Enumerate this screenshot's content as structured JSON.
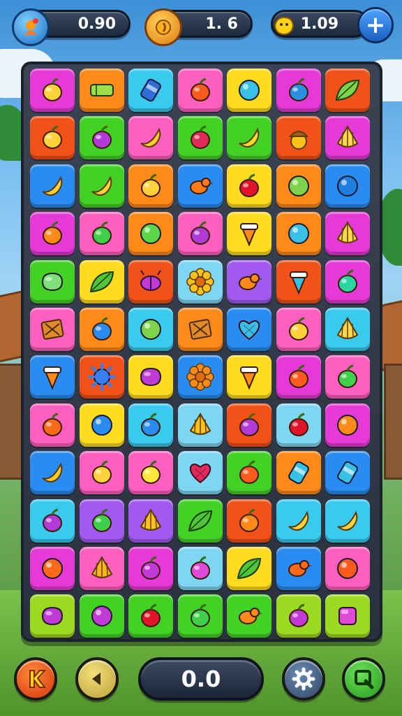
{
  "hud": {
    "stat1_value": "0.90",
    "stat2_value": "1.  6",
    "stat3_value": "1.09"
  },
  "footer": {
    "score_value": "0.0"
  },
  "colors": {
    "magenta": "#e63ad6",
    "orange": "#ff8a1a",
    "cyan": "#3ac9ef",
    "pink": "#ff5fbf",
    "yellow": "#ffdc1f",
    "purple": "#a05af0",
    "red": "#f25218",
    "green": "#44d126",
    "blue": "#2a8cf0",
    "lime": "#9cd921",
    "lightblue": "#7fd6f2"
  },
  "board": [
    [
      {
        "bg": "magenta",
        "icon": "fruit",
        "c": "#ffd23a"
      },
      {
        "bg": "orange",
        "icon": "bar",
        "c": "#9be04a"
      },
      {
        "bg": "cyan",
        "icon": "can",
        "c": "#2d6fd6"
      },
      {
        "bg": "pink",
        "icon": "fruit",
        "c": "#ff5a1e"
      },
      {
        "bg": "yellow",
        "icon": "orb",
        "c": "#39c0e6"
      },
      {
        "bg": "magenta",
        "icon": "fruit",
        "c": "#2b8fe0"
      },
      {
        "bg": "red",
        "icon": "leaf",
        "c": "#7dd34a"
      }
    ],
    [
      {
        "bg": "red",
        "icon": "fruit",
        "c": "#ffd23a"
      },
      {
        "bg": "green",
        "icon": "fruit",
        "c": "#b23ad6"
      },
      {
        "bg": "pink",
        "icon": "banana",
        "c": "#ffcc2a"
      },
      {
        "bg": "green",
        "icon": "fruit",
        "c": "#e02a5a"
      },
      {
        "bg": "green",
        "icon": "banana",
        "c": "#ffdc2a"
      },
      {
        "bg": "red",
        "icon": "acorn",
        "c": "#ffc21a"
      },
      {
        "bg": "magenta",
        "icon": "shell",
        "c": "#ffd84a"
      }
    ],
    [
      {
        "bg": "blue",
        "icon": "banana",
        "c": "#ffd23a"
      },
      {
        "bg": "green",
        "icon": "banana",
        "c": "#ffd23a"
      },
      {
        "bg": "orange",
        "icon": "fruit",
        "c": "#ffd23a"
      },
      {
        "bg": "blue",
        "icon": "bird",
        "c": "#ff7a1a"
      },
      {
        "bg": "yellow",
        "icon": "fruit",
        "c": "#e0142a"
      },
      {
        "bg": "orange",
        "icon": "orb",
        "c": "#7dd34a"
      },
      {
        "bg": "blue",
        "icon": "orb",
        "c": "#1e7fe0"
      }
    ],
    [
      {
        "bg": "magenta",
        "icon": "fruit",
        "c": "#ff8a1a"
      },
      {
        "bg": "pink",
        "icon": "fruit",
        "c": "#3fcf4a"
      },
      {
        "bg": "orange",
        "icon": "orb",
        "c": "#5ad84a"
      },
      {
        "bg": "pink",
        "icon": "fruit",
        "c": "#b23ad6"
      },
      {
        "bg": "yellow",
        "icon": "top",
        "c": "#ff8a1a"
      },
      {
        "bg": "orange",
        "icon": "orb",
        "c": "#39c0e6"
      },
      {
        "bg": "magenta",
        "icon": "shell",
        "c": "#ffd84a"
      }
    ],
    [
      {
        "bg": "green",
        "icon": "blob",
        "c": "#7de07a"
      },
      {
        "bg": "yellow",
        "icon": "leaf",
        "c": "#4fc43a"
      },
      {
        "bg": "red",
        "icon": "bug",
        "c": "#c23ad6"
      },
      {
        "bg": "lightblue",
        "icon": "flower",
        "c": "#ffc21a"
      },
      {
        "bg": "purple",
        "icon": "bird",
        "c": "#ff8a1a"
      },
      {
        "bg": "red",
        "icon": "top",
        "c": "#39c0e6"
      },
      {
        "bg": "magenta",
        "icon": "fruit",
        "c": "#2ad6a0"
      }
    ],
    [
      {
        "bg": "pink",
        "icon": "crate",
        "c": "#e08a2a"
      },
      {
        "bg": "orange",
        "icon": "fruit",
        "c": "#2a8cf0"
      },
      {
        "bg": "cyan",
        "icon": "orb",
        "c": "#7dd34a"
      },
      {
        "bg": "orange",
        "icon": "crate",
        "c": "#e08a2a"
      },
      {
        "bg": "blue",
        "icon": "heart",
        "c": "#39c0e6"
      },
      {
        "bg": "pink",
        "icon": "fruit",
        "c": "#ffd23a"
      },
      {
        "bg": "cyan",
        "icon": "shell",
        "c": "#ffd84a"
      }
    ],
    [
      {
        "bg": "blue",
        "icon": "top",
        "c": "#ff8a1a"
      },
      {
        "bg": "red",
        "icon": "spiky",
        "c": "#3a7ff0"
      },
      {
        "bg": "yellow",
        "icon": "blob",
        "c": "#c23ad6"
      },
      {
        "bg": "blue",
        "icon": "flower",
        "c": "#ff8a1a"
      },
      {
        "bg": "yellow",
        "icon": "top",
        "c": "#ff8a1a"
      },
      {
        "bg": "magenta",
        "icon": "fruit",
        "c": "#ff5a1e"
      },
      {
        "bg": "pink",
        "icon": "fruit",
        "c": "#3fcf4a"
      }
    ],
    [
      {
        "bg": "pink",
        "icon": "fruit",
        "c": "#ff6a1a"
      },
      {
        "bg": "yellow",
        "icon": "orb",
        "c": "#2a8cf0"
      },
      {
        "bg": "cyan",
        "icon": "fruit",
        "c": "#2a8cf0"
      },
      {
        "bg": "lightblue",
        "icon": "shell",
        "c": "#ffc21a"
      },
      {
        "bg": "red",
        "icon": "fruit",
        "c": "#b23ad6"
      },
      {
        "bg": "lightblue",
        "icon": "fruit",
        "c": "#e0142a"
      },
      {
        "bg": "magenta",
        "icon": "orb",
        "c": "#ff8a1a"
      }
    ],
    [
      {
        "bg": "blue",
        "icon": "banana",
        "c": "#ffcc2a"
      },
      {
        "bg": "pink",
        "icon": "fruit",
        "c": "#ffd23a"
      },
      {
        "bg": "pink",
        "icon": "fruit",
        "c": "#ffe83a"
      },
      {
        "bg": "lightblue",
        "icon": "heart",
        "c": "#e02a5a"
      },
      {
        "bg": "green",
        "icon": "fruit",
        "c": "#ff5a1e"
      },
      {
        "bg": "orange",
        "icon": "can",
        "c": "#39c0e6"
      },
      {
        "bg": "blue",
        "icon": "can",
        "c": "#39c0e6"
      }
    ],
    [
      {
        "bg": "cyan",
        "icon": "fruit",
        "c": "#b23ad6"
      },
      {
        "bg": "purple",
        "icon": "fruit",
        "c": "#3fcf4a"
      },
      {
        "bg": "purple",
        "icon": "shell",
        "c": "#ffc21a"
      },
      {
        "bg": "green",
        "icon": "leaf",
        "c": "#4fc43a"
      },
      {
        "bg": "red",
        "icon": "fruit",
        "c": "#ff8a1a"
      },
      {
        "bg": "cyan",
        "icon": "banana",
        "c": "#ffd23a"
      },
      {
        "bg": "cyan",
        "icon": "banana",
        "c": "#ffd23a"
      }
    ],
    [
      {
        "bg": "magenta",
        "icon": "orb",
        "c": "#ff6a1a"
      },
      {
        "bg": "pink",
        "icon": "shell",
        "c": "#ffb21a"
      },
      {
        "bg": "magenta",
        "icon": "fruit",
        "c": "#c23ad6"
      },
      {
        "bg": "lightblue",
        "icon": "fruit",
        "c": "#e04ad6"
      },
      {
        "bg": "yellow",
        "icon": "leaf",
        "c": "#4fc43a"
      },
      {
        "bg": "blue",
        "icon": "bird",
        "c": "#ff6a1a"
      },
      {
        "bg": "pink",
        "icon": "orb",
        "c": "#ff5a1e"
      }
    ],
    [
      {
        "bg": "lime",
        "icon": "blob",
        "c": "#c23ad6"
      },
      {
        "bg": "green",
        "icon": "orb",
        "c": "#c23ad6"
      },
      {
        "bg": "green",
        "icon": "fruit",
        "c": "#e0142a"
      },
      {
        "bg": "green",
        "icon": "fruit",
        "c": "#3fcf4a"
      },
      {
        "bg": "green",
        "icon": "bird",
        "c": "#ff8a1a"
      },
      {
        "bg": "lime",
        "icon": "fruit",
        "c": "#c23ad6"
      },
      {
        "bg": "lime",
        "icon": "box",
        "c": "#e04ad6"
      }
    ]
  ]
}
